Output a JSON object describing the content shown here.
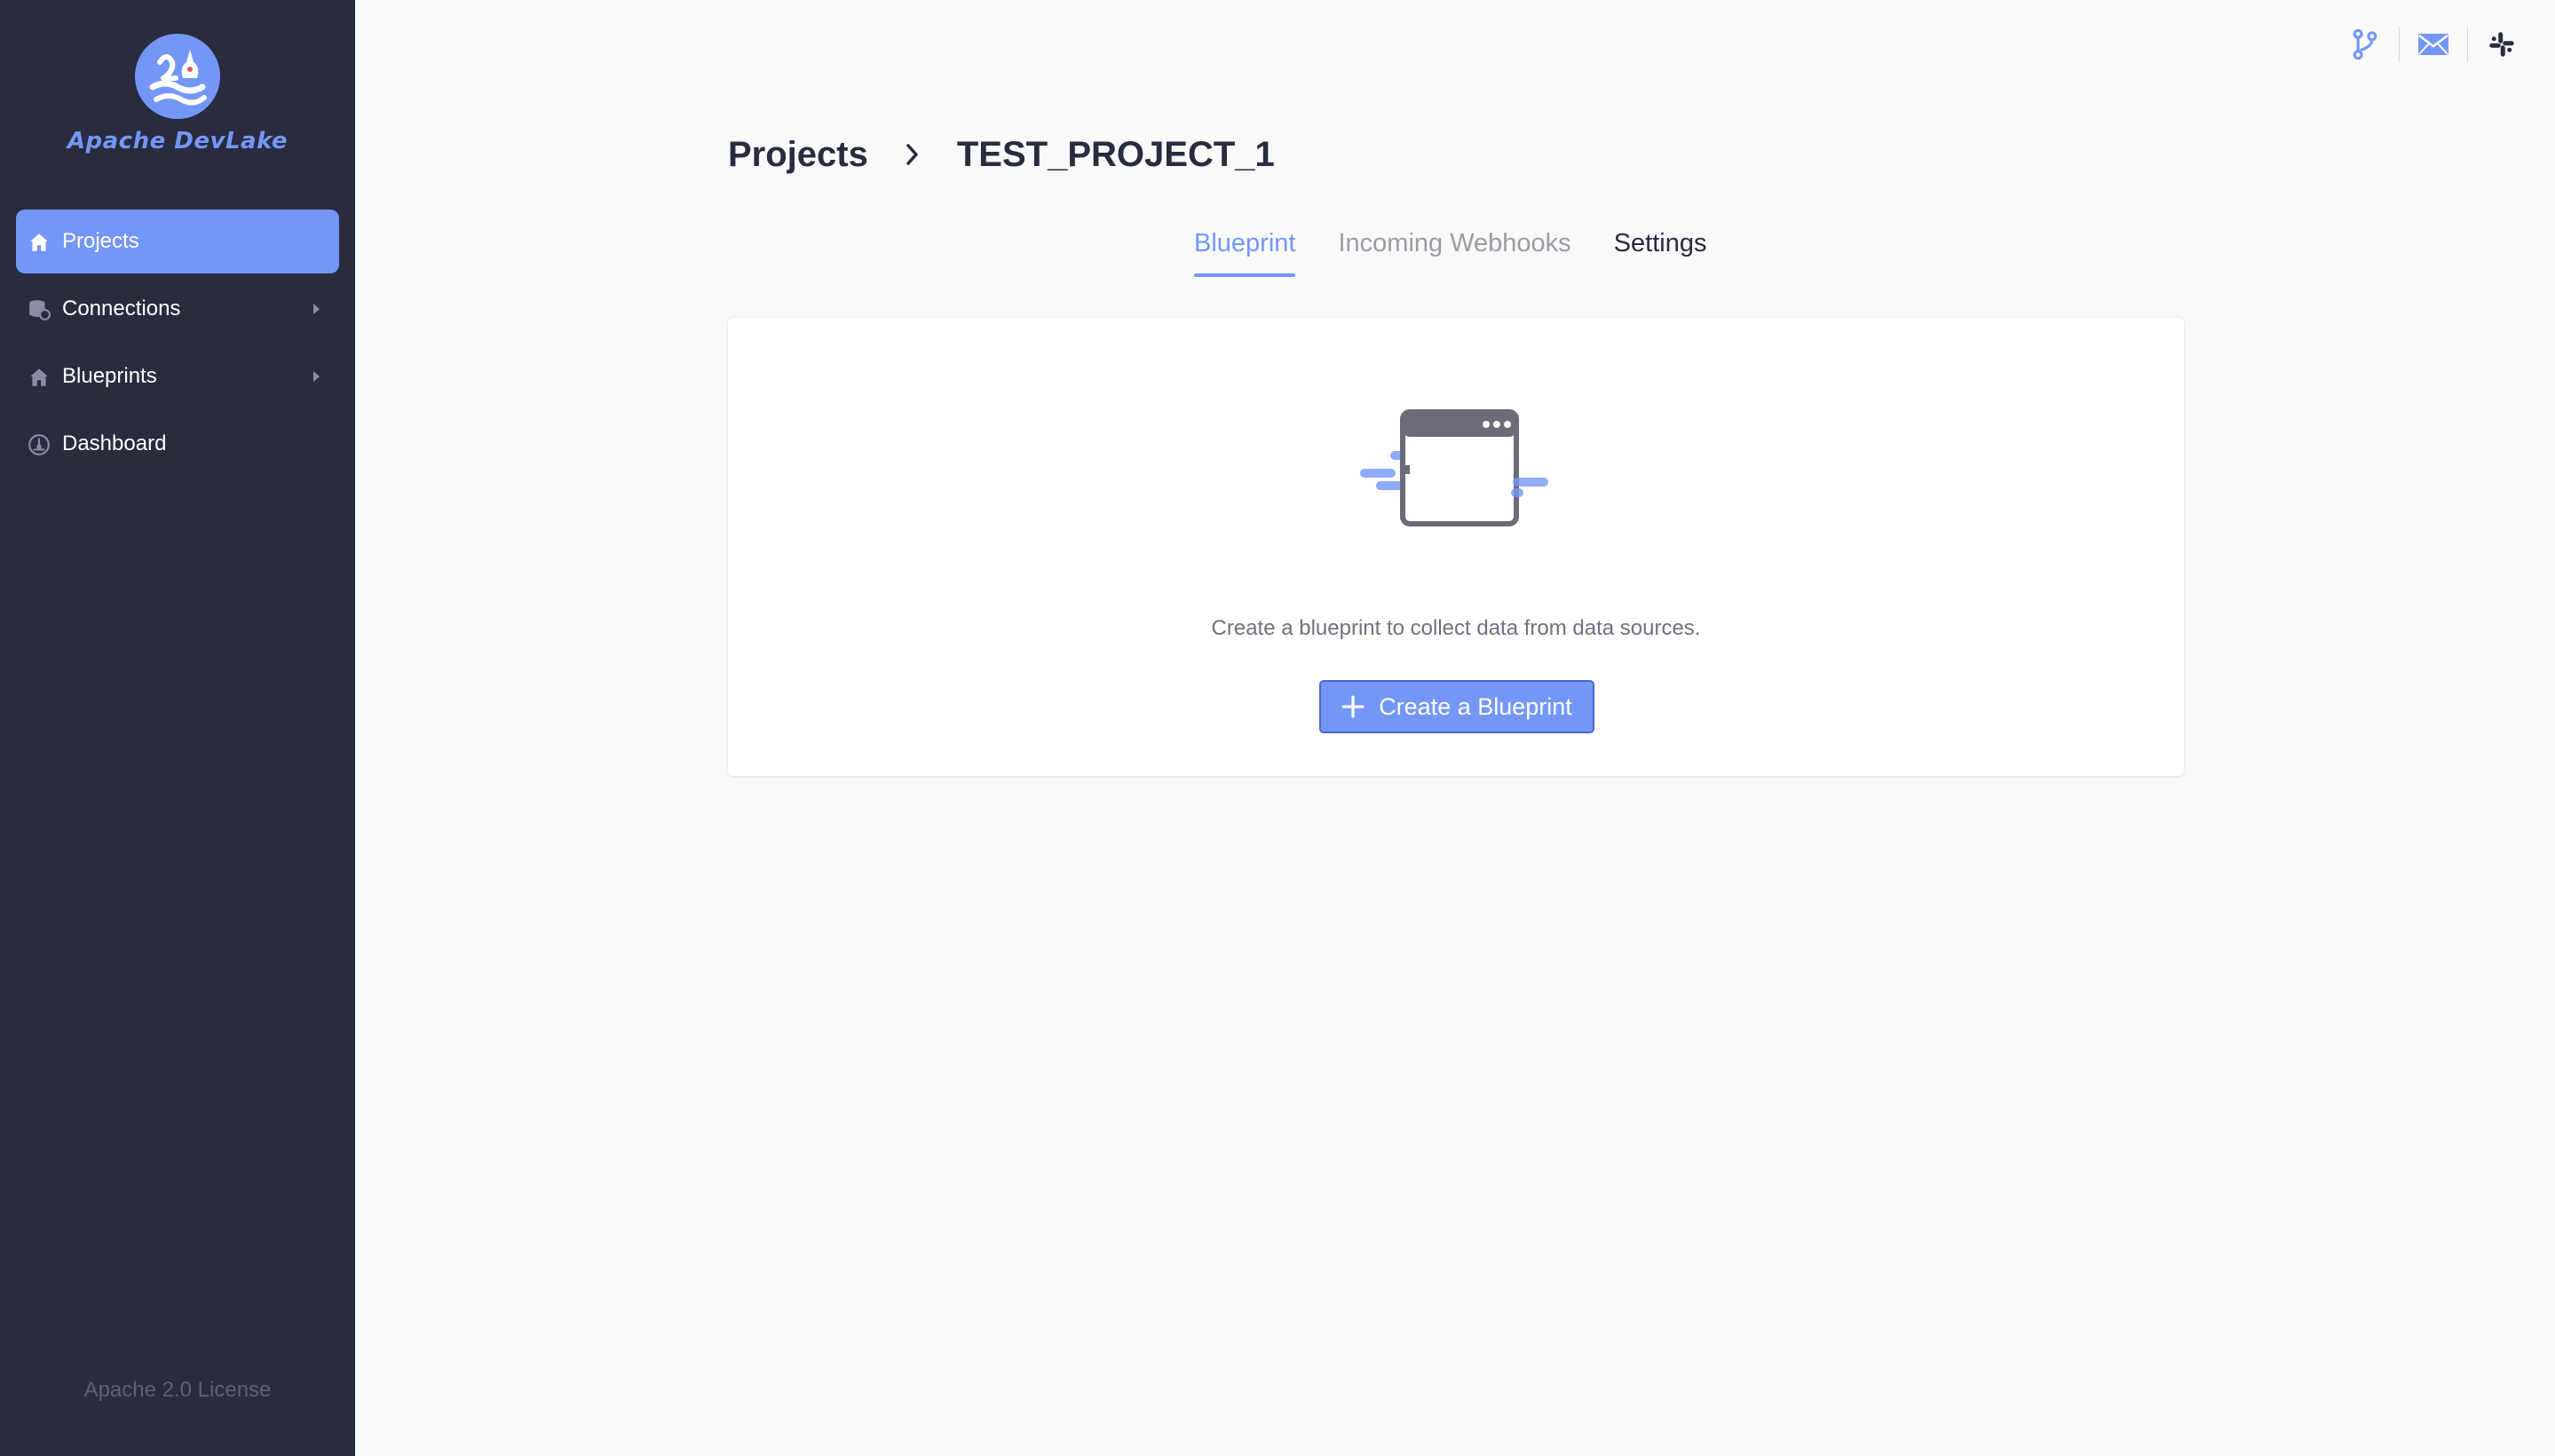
{
  "app": {
    "brand": "Apache DevLake",
    "license": "Apache 2.0 License"
  },
  "sidebar": {
    "items": [
      {
        "label": "Projects",
        "icon": "home-icon",
        "active": true
      },
      {
        "label": "Connections",
        "icon": "database-icon",
        "expandable": true
      },
      {
        "label": "Blueprints",
        "icon": "home-icon",
        "expandable": true
      },
      {
        "label": "Dashboard",
        "icon": "dashboard-icon"
      }
    ]
  },
  "header": {
    "icons": [
      "git-branch-icon",
      "mail-icon",
      "slack-icon"
    ]
  },
  "breadcrumb": {
    "root": "Projects",
    "current": "TEST_PROJECT_1"
  },
  "tabs": [
    {
      "label": "Blueprint",
      "state": "active"
    },
    {
      "label": "Incoming Webhooks",
      "state": "inactive"
    },
    {
      "label": "Settings",
      "state": "inactive"
    }
  ],
  "empty_state": {
    "message": "Create a blueprint to collect data from data sources.",
    "button_label": "Create a Blueprint",
    "illustration": "browser-window-illustration"
  },
  "colors": {
    "primary": "#7497f7",
    "sidebar_bg": "#292b3f",
    "page_bg": "#f9f9fa",
    "text_dark": "#292b3f",
    "text_muted": "#9a9ba6"
  }
}
